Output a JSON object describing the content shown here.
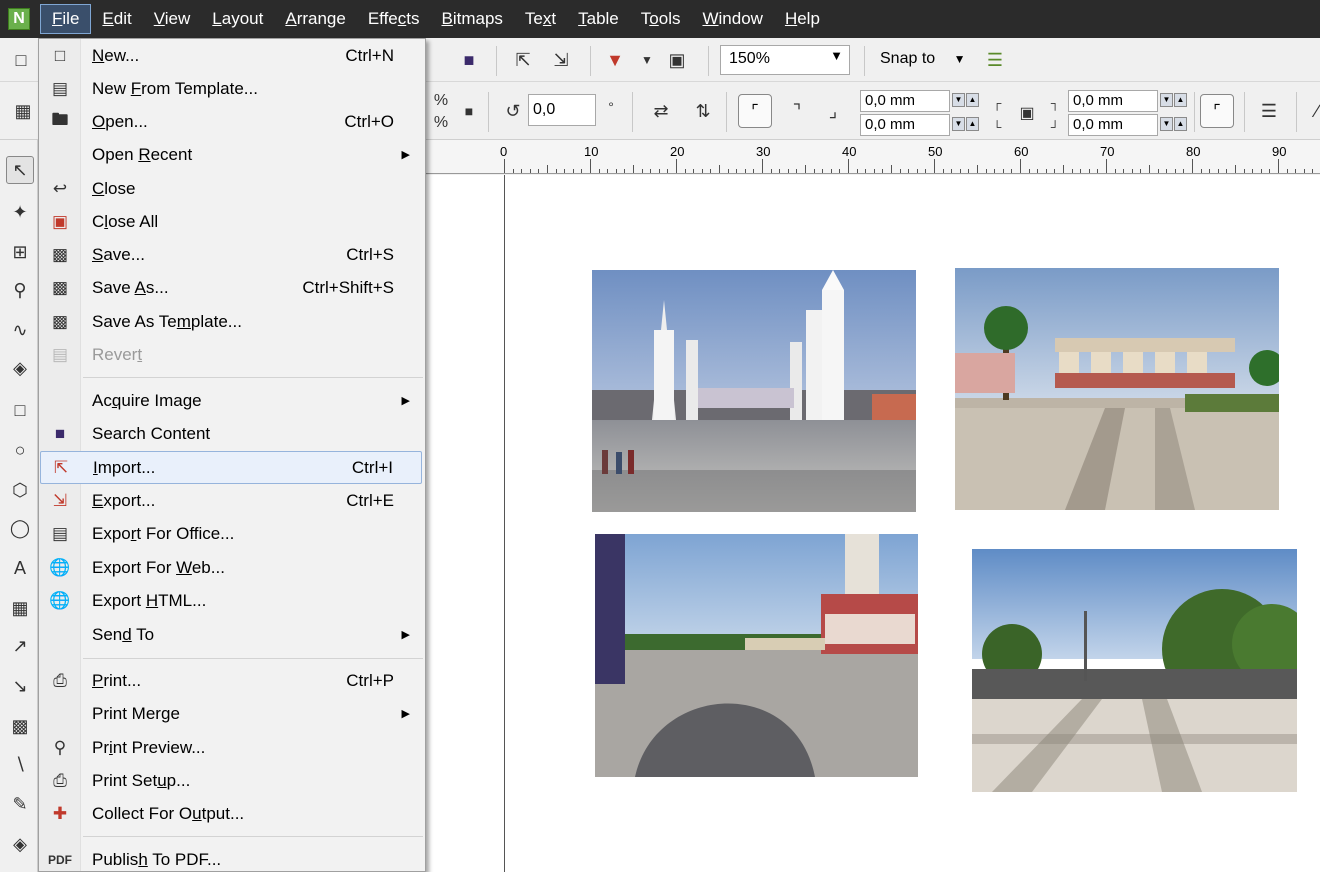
{
  "menubar": {
    "items": [
      {
        "pre": "",
        "u": "F",
        "post": "ile"
      },
      {
        "pre": "",
        "u": "E",
        "post": "dit"
      },
      {
        "pre": "",
        "u": "V",
        "post": "iew"
      },
      {
        "pre": "",
        "u": "L",
        "post": "ayout"
      },
      {
        "pre": "",
        "u": "A",
        "post": "rrange"
      },
      {
        "pre": "Effe",
        "u": "c",
        "post": "ts"
      },
      {
        "pre": "",
        "u": "B",
        "post": "itmaps"
      },
      {
        "pre": "Te",
        "u": "x",
        "post": "t"
      },
      {
        "pre": "",
        "u": "T",
        "post": "able"
      },
      {
        "pre": "T",
        "u": "o",
        "post": "ols"
      },
      {
        "pre": "",
        "u": "W",
        "post": "indow"
      },
      {
        "pre": "",
        "u": "H",
        "post": "elp"
      }
    ]
  },
  "toolbar": {
    "zoom": "150%",
    "snap_label": "Snap to",
    "rotation": "0,0",
    "degree": "°",
    "percent": "%",
    "pos_x1": "0,0 mm",
    "pos_y1": "0,0 mm",
    "pos_x2": "0,0 mm",
    "pos_y2": "0,0 mm"
  },
  "ruler": {
    "labels": [
      "0",
      "10",
      "20",
      "30",
      "40",
      "50",
      "60",
      "70",
      "80",
      "90"
    ]
  },
  "file_menu": {
    "items": [
      {
        "pre": "",
        "u": "N",
        "post": "ew...",
        "shortcut": "Ctrl+N"
      },
      {
        "pre": "New ",
        "u": "F",
        "post": "rom Template...",
        "shortcut": ""
      },
      {
        "pre": "",
        "u": "O",
        "post": "pen...",
        "shortcut": "Ctrl+O"
      },
      {
        "pre": "Open ",
        "u": "R",
        "post": "ecent",
        "shortcut": ""
      },
      {
        "pre": "",
        "u": "C",
        "post": "lose",
        "shortcut": ""
      },
      {
        "pre": "C",
        "u": "l",
        "post": "ose All",
        "shortcut": ""
      },
      {
        "pre": "",
        "u": "S",
        "post": "ave...",
        "shortcut": "Ctrl+S"
      },
      {
        "pre": "Save ",
        "u": "A",
        "post": "s...",
        "shortcut": "Ctrl+Shift+S"
      },
      {
        "pre": "Save As Te",
        "u": "m",
        "post": "plate...",
        "shortcut": ""
      },
      {
        "pre": "Rever",
        "u": "t",
        "post": "",
        "shortcut": ""
      },
      {
        "pre": "Ac",
        "u": "q",
        "post": "uire Image",
        "shortcut": ""
      },
      {
        "pre": "Search Content",
        "u": "",
        "post": "",
        "shortcut": ""
      },
      {
        "pre": "",
        "u": "I",
        "post": "mport...",
        "shortcut": "Ctrl+I"
      },
      {
        "pre": "",
        "u": "E",
        "post": "xport...",
        "shortcut": "Ctrl+E"
      },
      {
        "pre": "Expo",
        "u": "r",
        "post": "t For Office...",
        "shortcut": ""
      },
      {
        "pre": "Export For ",
        "u": "W",
        "post": "eb...",
        "shortcut": ""
      },
      {
        "pre": "Export ",
        "u": "H",
        "post": "TML...",
        "shortcut": ""
      },
      {
        "pre": "Sen",
        "u": "d",
        "post": " To",
        "shortcut": ""
      },
      {
        "pre": "",
        "u": "P",
        "post": "rint...",
        "shortcut": "Ctrl+P"
      },
      {
        "pre": "Print Mer",
        "u": "g",
        "post": "e",
        "shortcut": ""
      },
      {
        "pre": "Pr",
        "u": "i",
        "post": "nt Preview...",
        "shortcut": ""
      },
      {
        "pre": "Print Set",
        "u": "u",
        "post": "p...",
        "shortcut": ""
      },
      {
        "pre": "Collect For O",
        "u": "u",
        "post": "tput...",
        "shortcut": ""
      },
      {
        "pre": "Publis",
        "u": "h",
        "post": " To PDF...",
        "shortcut": ""
      }
    ]
  }
}
